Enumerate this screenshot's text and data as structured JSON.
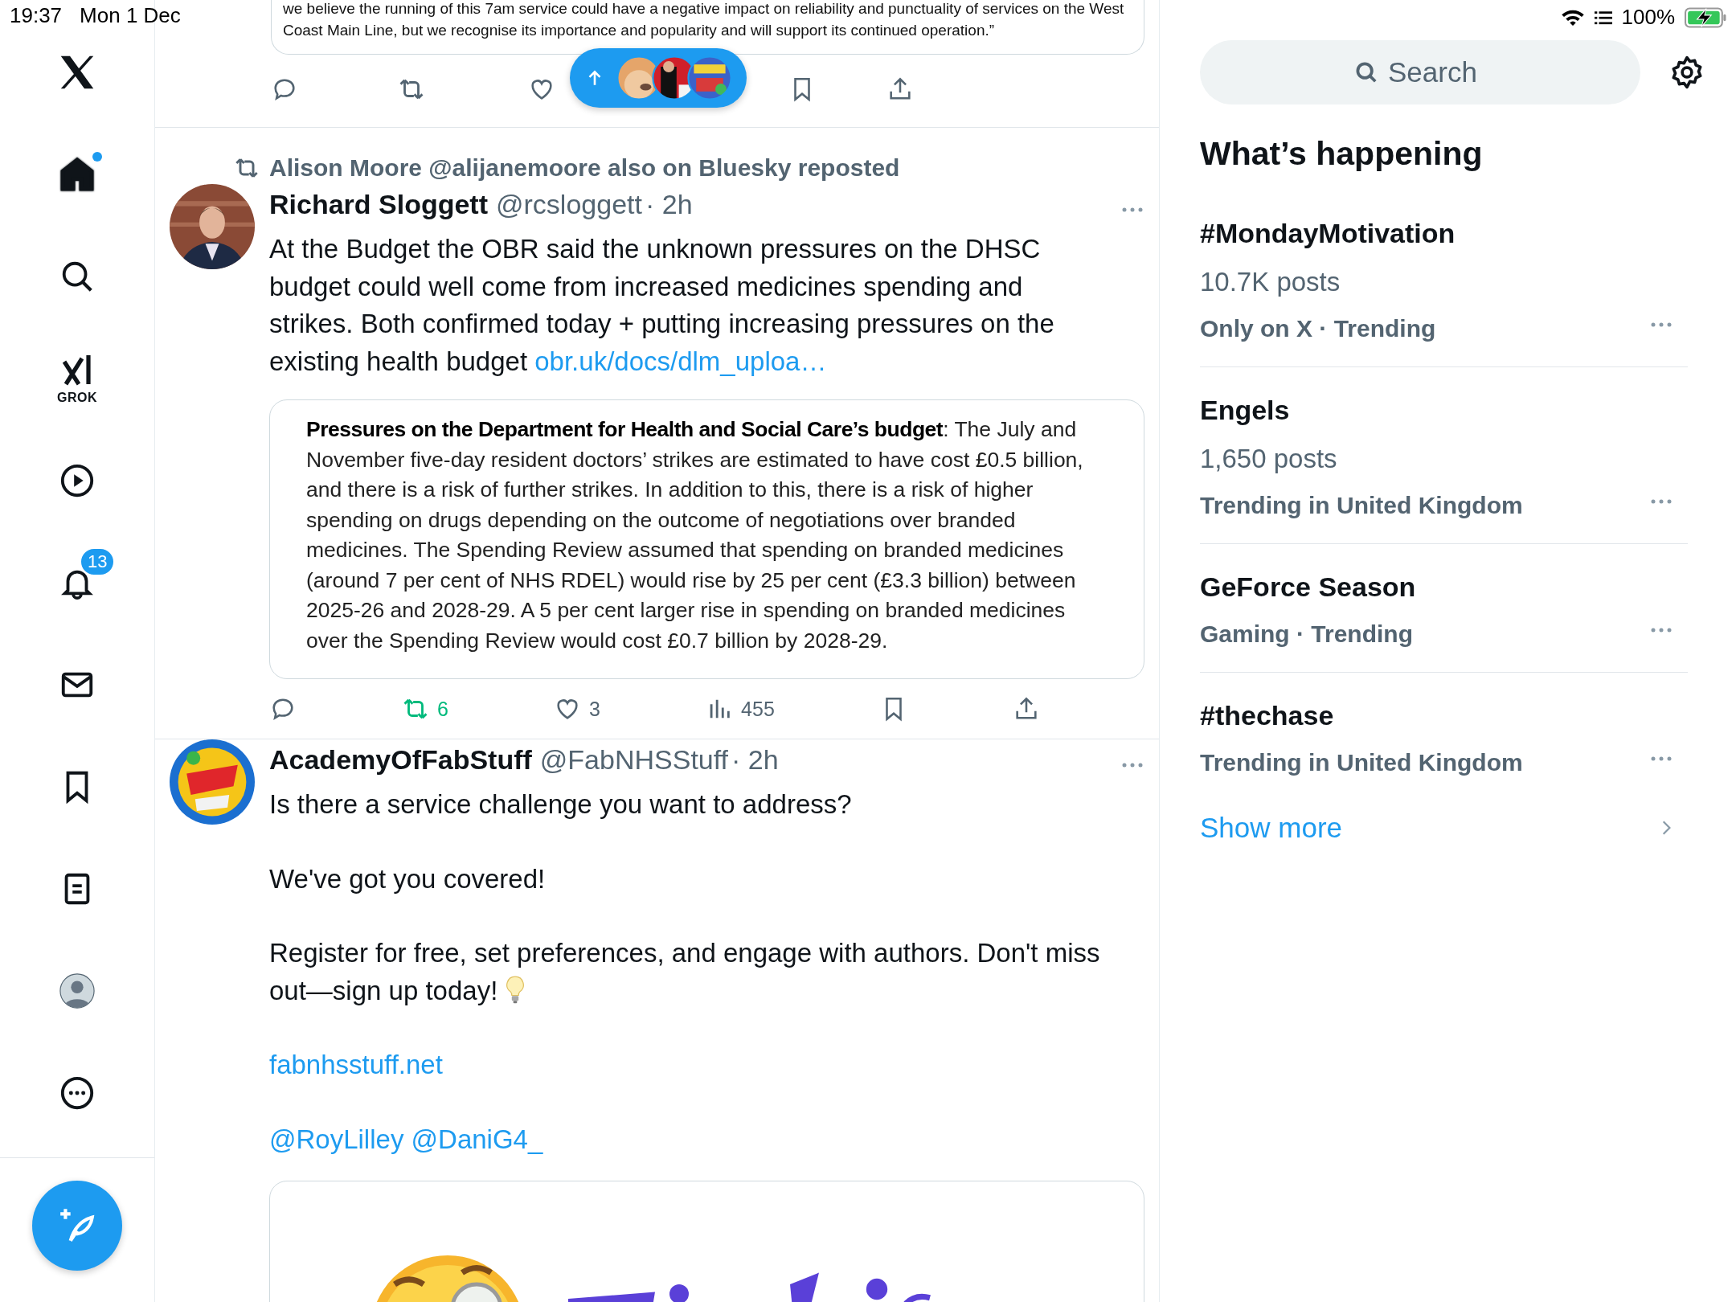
{
  "status_bar": {
    "time": "19:37",
    "date": "Mon 1 Dec",
    "battery": "100%",
    "charging": true
  },
  "sidebar": {
    "items": [
      {
        "kind": "logo",
        "selected": false
      },
      {
        "kind": "home",
        "selected": true,
        "unread": true
      },
      {
        "kind": "explore",
        "selected": false
      },
      {
        "kind": "grok",
        "selected": false,
        "label": "GROK"
      },
      {
        "kind": "video",
        "selected": false
      },
      {
        "kind": "notifications",
        "selected": false,
        "badge": "13"
      },
      {
        "kind": "messages",
        "selected": false
      },
      {
        "kind": "bookmarks",
        "selected": false
      },
      {
        "kind": "lists",
        "selected": false
      },
      {
        "kind": "profile",
        "selected": false
      },
      {
        "kind": "more",
        "selected": false
      }
    ]
  },
  "feed": {
    "top_tweet": {
      "quote_lines": [
        "we believe the running of this 7am service could have a negative impact on reliability and punctuality of services on the West",
        "Coast Main Line, but we recognise its importance and popularity and will support its continued operation.”"
      ]
    },
    "tweets": [
      {
        "repost_by": "Alison Moore @alijanemoore also on Bluesky reposted",
        "name": "Richard Sloggett",
        "handle": "@rcsloggett",
        "time": "· 2h",
        "paragraphs": [
          {
            "kind": "text",
            "text": "At the Budget the OBR said the unknown pressures on the DHSC budget could well come from increased medicines spending and strikes. Both confirmed today + putting increasing pressures on the existing health budget",
            "link": "obr.uk/docs/dlm_uploa…"
          }
        ],
        "quote": "**Pressures on the Department for Health and Social Care’s budget**: The July and November five-day resident doctors’ strikes are estimated to have cost £0.5 billion, and there is a risk of further strikes. In addition to this, there is a risk of higher spending on drugs depending on the outcome of negotiations over branded medicines. The Spending Review assumed that spending on branded medicines (around 7 per cent of NHS RDEL) would rise by 25 per cent (£3.3 billion) between 2025-26 and 2028-29. A 5 per cent larger rise in spending on branded medicines over the Spending Review would cost £0.7 billion by 2028-29.",
        "stats": {
          "reposts": "6",
          "reposted": true,
          "likes": "3",
          "liked": false,
          "views": "455"
        }
      },
      {
        "name": "AcademyOfFabStuff",
        "handle": "@FabNHSStuff",
        "time": "· 2h",
        "paragraphs": [
          {
            "kind": "text",
            "text": "Is there a service challenge you want to address?"
          },
          {
            "kind": "text",
            "text": "We've got you covered!"
          },
          {
            "kind": "text",
            "text": "Register for free, set preferences, and engage with authors. Don't miss out—sign up today!",
            "bulb": true
          },
          {
            "kind": "link",
            "text": "fabnhsstuff.net"
          },
          {
            "kind": "mentions",
            "links": [
              "@RoyLilley",
              "@DaniG4_"
            ]
          }
        ]
      }
    ]
  },
  "right": {
    "search": {
      "placeholder": "Search"
    },
    "heading": "What’s happening",
    "trends": [
      {
        "name": "#MondayMotivation",
        "posts": "10.7K posts",
        "meta": "Only on X · Trending"
      },
      {
        "name": "Engels",
        "posts": "1,650 posts",
        "meta": "Trending in United Kingdom"
      },
      {
        "name": "GeForce Season",
        "meta": "Gaming · Trending"
      },
      {
        "name": "#thechase",
        "meta": "Trending in United Kingdom"
      }
    ],
    "show_more": "Show more"
  }
}
